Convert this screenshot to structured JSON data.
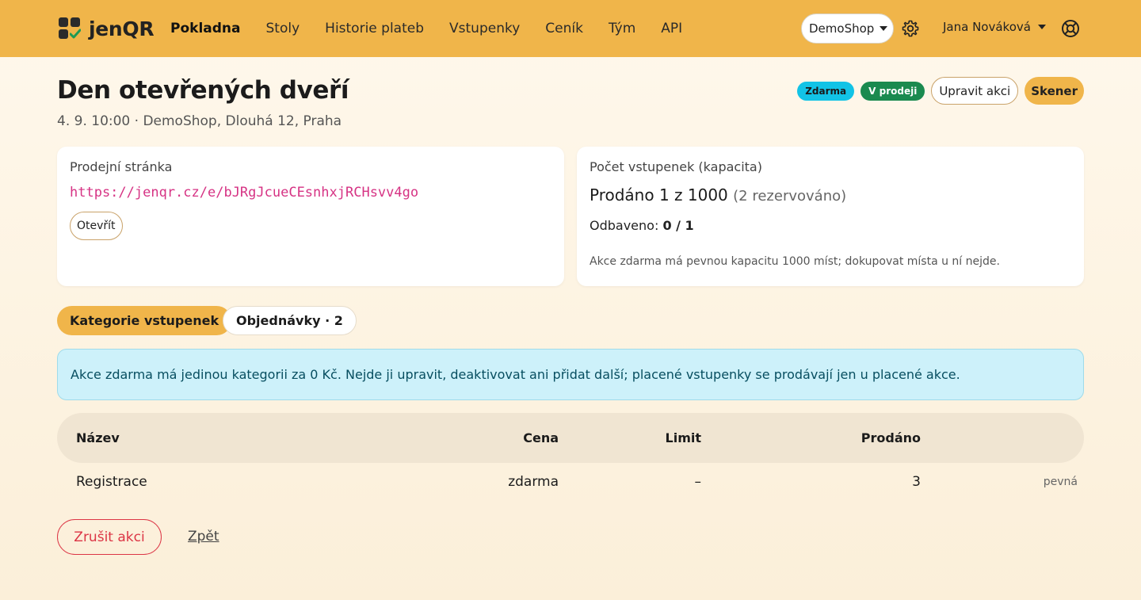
{
  "app": {
    "brand_name": "jenQR",
    "accent_color": "#f0b54a",
    "icons": {
      "logo": "jenqr-logo-icon",
      "settings": "gear-icon",
      "help": "lifebuoy-icon",
      "dropdown": "chevron-down-icon"
    }
  },
  "nav": {
    "items": [
      {
        "label": "Pokladna",
        "active": true
      },
      {
        "label": "Stoly"
      },
      {
        "label": "Historie plateb"
      },
      {
        "label": "Vstupenky"
      },
      {
        "label": "Ceník"
      },
      {
        "label": "Tým"
      },
      {
        "label": "API"
      }
    ],
    "shop_selected": "DemoShop",
    "user_name": "Jana Nováková"
  },
  "event": {
    "title": "Den otevřených dveří",
    "subtitle": "4. 9. 10:00 · DemoShop, Dlouhá 12, Praha",
    "badge_free": "Zdarma",
    "badge_status": "V prodeji",
    "edit_label": "Upravit akci",
    "scanner_label": "Skener"
  },
  "sale_page": {
    "title": "Prodejní stránka",
    "url": "https://jenqr.cz/e/bJRgJcueCEsnhxjRCHsvv4go",
    "open_label": "Otevřít"
  },
  "capacity": {
    "title": "Počet vstupenek (kapacita)",
    "sold_text": "Prodáno 1 z 1000",
    "reserved_text": "(2 rezervováno)",
    "checked_label": "Odbaveno:",
    "checked_value": "0 / 1",
    "note": "Akce zdarma má pevnou kapacitu 1000 míst; dokupovat místa u ní nejde."
  },
  "tabs": {
    "categories": "Kategorie vstupenek",
    "orders": "Objednávky · 2"
  },
  "alert": {
    "text": "Akce zdarma má jedinou kategorii za 0 Kč. Nejde ji upravit, deaktivovat ani přidat další; placené vstupenky se prodávají jen u placené akce."
  },
  "table": {
    "headers": {
      "name": "Název",
      "price": "Cena",
      "limit": "Limit",
      "sold": "Prodáno"
    },
    "rows": [
      {
        "name": "Registrace",
        "price": "zdarma",
        "limit": "–",
        "sold": "3",
        "note": "pevná"
      }
    ]
  },
  "footer": {
    "cancel_label": "Zrušit akci",
    "back_label": "Zpět"
  }
}
